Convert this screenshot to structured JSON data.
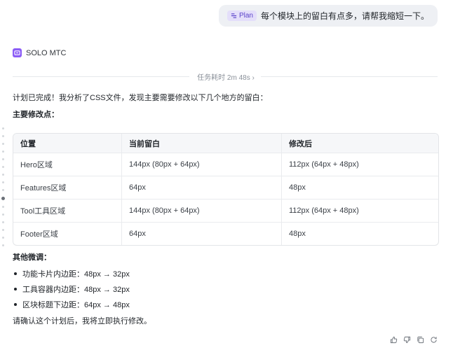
{
  "user_message": {
    "tag_label": "Plan",
    "text": "每个模块上的留白有点多，请帮我缩短一下。"
  },
  "agent": {
    "name": "SOLO MTC",
    "logo_color": "#8b5cf6"
  },
  "duration": {
    "label": "任务耗时 2m 48s"
  },
  "response": {
    "intro": "计划已完成！我分析了CSS文件，发现主要需要修改以下几个地方的留白：",
    "main_heading": "主要修改点：",
    "table": {
      "headers": [
        "位置",
        "当前留白",
        "修改后"
      ],
      "rows": [
        [
          "Hero区域",
          "144px (80px + 64px)",
          "112px (64px + 48px)"
        ],
        [
          "Features区域",
          "64px",
          "48px"
        ],
        [
          "Tool工具区域",
          "144px (80px + 64px)",
          "112px (64px + 48px)"
        ],
        [
          "Footer区域",
          "64px",
          "48px"
        ]
      ]
    },
    "other_heading": "其他微调：",
    "bullets": [
      "功能卡片内边距：48px → 32px",
      "工具容器内边距：48px → 32px",
      "区块标题下边距：64px → 48px"
    ],
    "closing": "请确认这个计划后，我将立即执行修改。"
  },
  "actions": [
    "thumbs-up-icon",
    "thumbs-down-icon",
    "copy-icon",
    "regenerate-icon"
  ]
}
